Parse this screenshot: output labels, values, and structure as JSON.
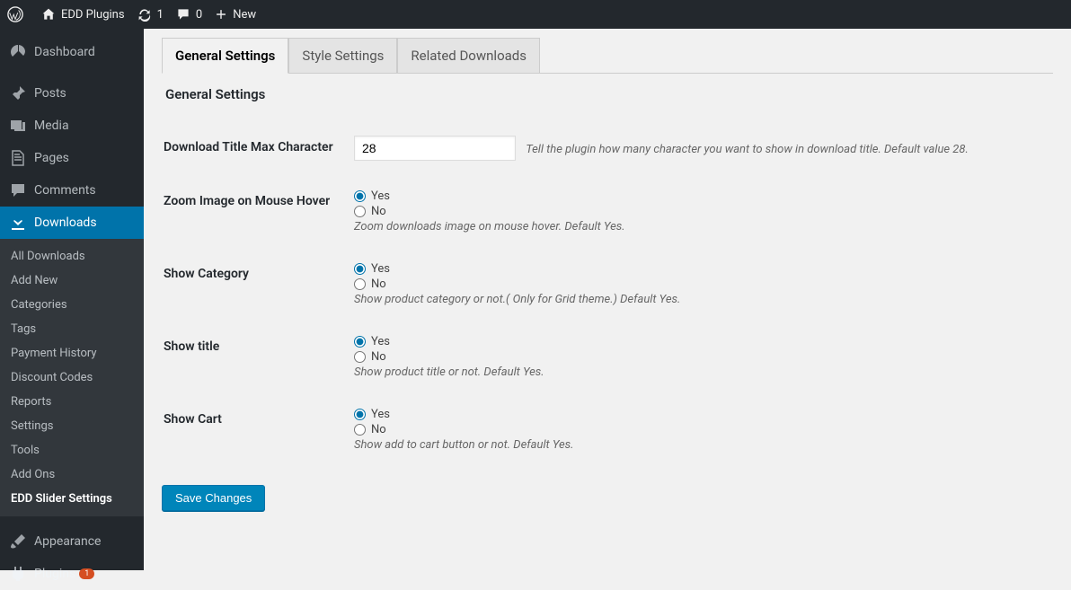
{
  "toolbar": {
    "site_name": "EDD Plugins",
    "updates": "1",
    "comments": "0",
    "new": "New"
  },
  "sidebar": {
    "dashboard": "Dashboard",
    "posts": "Posts",
    "media": "Media",
    "pages": "Pages",
    "comments": "Comments",
    "downloads": "Downloads",
    "submenu": {
      "all": "All Downloads",
      "addnew": "Add New",
      "categories": "Categories",
      "tags": "Tags",
      "payment": "Payment History",
      "discount": "Discount Codes",
      "reports": "Reports",
      "settings": "Settings",
      "tools": "Tools",
      "addons": "Add Ons",
      "edd_slider": "EDD Slider Settings"
    },
    "appearance": "Appearance",
    "plugins": "Plugins",
    "plugins_badge": "1"
  },
  "tabs": {
    "general": "General Settings",
    "style": "Style Settings",
    "related": "Related Downloads"
  },
  "heading": "General Settings",
  "fields": {
    "title_max": {
      "label": "Download Title Max Character",
      "value": "28",
      "desc": "Tell the plugin how many character you want to show in download title. Default value 28."
    },
    "zoom": {
      "label": "Zoom Image on Mouse Hover",
      "yes": "Yes",
      "no": "No",
      "desc": "Zoom downloads image on mouse hover. Default Yes."
    },
    "category": {
      "label": "Show Category",
      "yes": "Yes",
      "no": "No",
      "desc": "Show product category or not.( Only for Grid theme.) Default Yes."
    },
    "showtitle": {
      "label": "Show title",
      "yes": "Yes",
      "no": "No",
      "desc": "Show product title or not. Default Yes."
    },
    "cart": {
      "label": "Show Cart",
      "yes": "Yes",
      "no": "No",
      "desc": "Show add to cart button or not. Default Yes."
    }
  },
  "save_button": "Save Changes"
}
